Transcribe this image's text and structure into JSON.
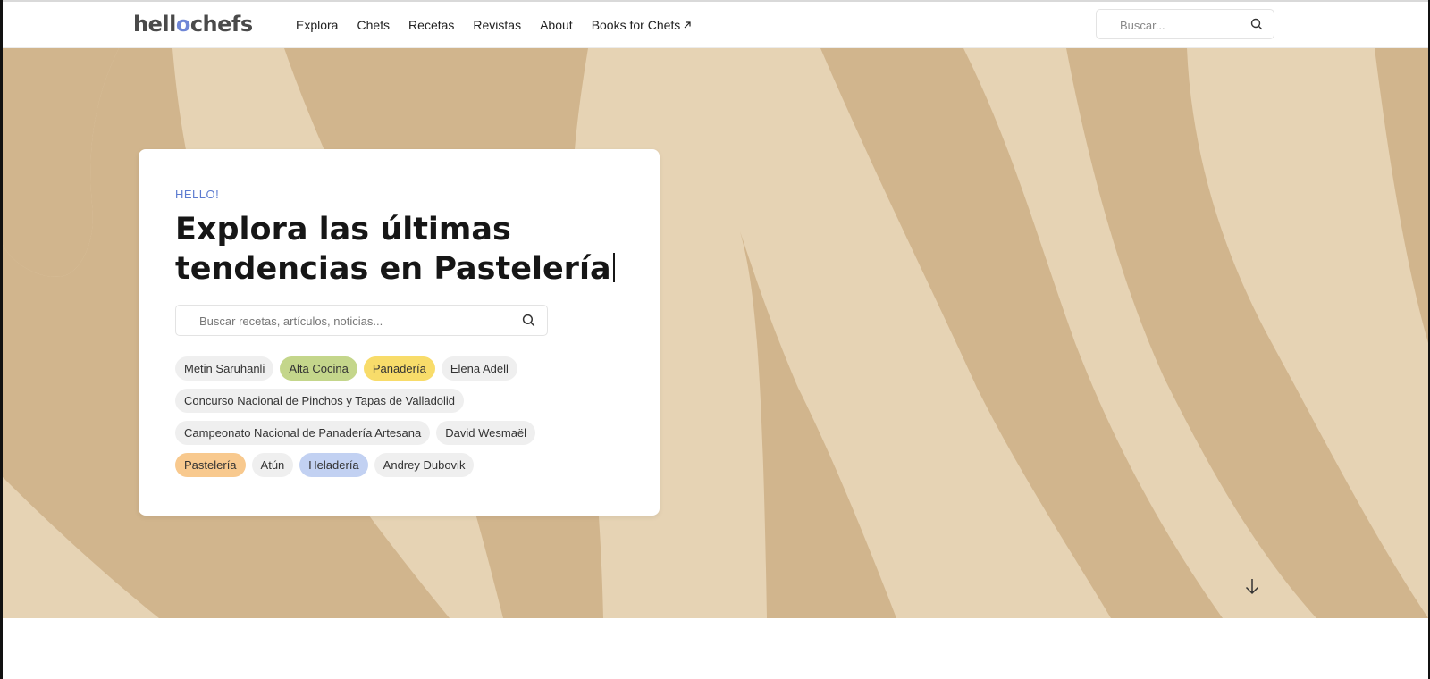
{
  "header": {
    "logo": {
      "part1": "hell",
      "accent": "o",
      "part2": "chefs"
    },
    "nav": [
      {
        "label": "Explora"
      },
      {
        "label": "Chefs"
      },
      {
        "label": "Recetas"
      },
      {
        "label": "Revistas"
      },
      {
        "label": "About"
      },
      {
        "label": "Books for Chefs",
        "icon": "external-link-icon"
      }
    ],
    "search": {
      "placeholder": "Buscar...",
      "icon": "search-icon"
    }
  },
  "hero": {
    "background_color": "#e6d3b4",
    "stripe_color": "#d1b58d",
    "card": {
      "eyebrow": "HELLO!",
      "headline_line1": "Explora las últimas",
      "headline_line2": "tendencias en Pastelería",
      "search": {
        "placeholder": "Buscar recetas, artículos, noticias...",
        "icon": "search-icon"
      },
      "tags": [
        [
          {
            "label": "Metin Saruhanli",
            "color": "#efefef"
          },
          {
            "label": "Alta Cocina",
            "color": "#c4d68b"
          },
          {
            "label": "Panadería",
            "color": "#f8dc6a"
          },
          {
            "label": "Elena Adell",
            "color": "#efefef"
          }
        ],
        [
          {
            "label": "Concurso Nacional de Pinchos y Tapas de Valladolid",
            "color": "#efefef"
          }
        ],
        [
          {
            "label": "Campeonato Nacional de Panadería Artesana",
            "color": "#efefef"
          },
          {
            "label": "David Wesmaël",
            "color": "#efefef"
          }
        ],
        [
          {
            "label": "Pastelería",
            "color": "#f8c98e"
          },
          {
            "label": "Atún",
            "color": "#efefef"
          },
          {
            "label": "Heladería",
            "color": "#c2d1f2"
          },
          {
            "label": "Andrey Dubovik",
            "color": "#efefef"
          }
        ]
      ]
    },
    "scroll_icon": "arrow-down-icon"
  },
  "colors": {
    "accent": "#6f86d6",
    "eyebrow": "#5c7bd0"
  }
}
